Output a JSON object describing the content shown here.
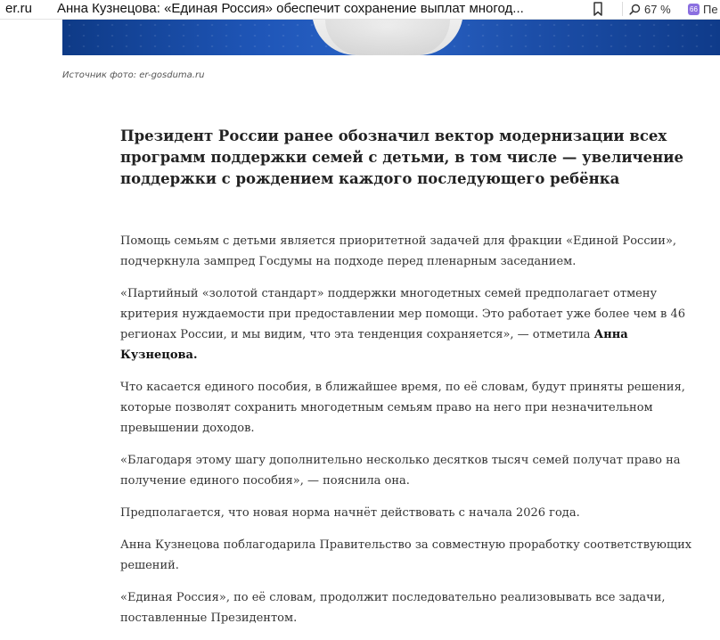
{
  "browser": {
    "site": "er.ru",
    "title": "Анна Кузнецова: «Единая Россия» обеспечит сохранение выплат многод...",
    "zoom": "67 %",
    "extension_label": "Пе",
    "extension_badge": "66"
  },
  "article": {
    "photo_source": "Источник фото: er-gosduma.ru",
    "lead": "Президент России ранее обозначил вектор модернизации всех программ поддержки семей с детьми, в том числе — увеличение поддержки с рождением каждого последующего ребёнка",
    "paragraphs": {
      "p1": "Помощь семьям с детьми является приоритетной задачей для фракции «Единой России», подчеркнула зампред Госдумы на подходе перед пленарным заседанием.",
      "p2_text": "«Партийный «золотой стандарт» поддержки многодетных семей предполагает отмену критерия нуждаемости при предоставлении мер помощи. Это работает уже более чем в 46 регионах России, и мы видим, что эта тенденция сохраняется», — отметила ",
      "p2_bold": "Анна Кузнецова.",
      "p3": "Что касается единого пособия, в ближайшее время, по её словам, будут приняты решения, которые позволят сохранить многодетным семьям право на него при незначительном превышении доходов.",
      "p4": "«Благодаря этому шагу дополнительно несколько десятков тысяч семей получат право на получение единого пособия», — пояснила она.",
      "p5": "Предполагается, что новая норма начнёт действовать с начала 2026 года.",
      "p6": "Анна Кузнецова поблагодарила Правительство за совместную проработку соответствующих решений.",
      "p7": "«Единая Россия», по её словам, продолжит последовательно реализовывать все задачи, поставленные Президентом."
    }
  },
  "icons": {
    "bookmark": "bookmark-icon",
    "zoom": "magnifier-icon"
  }
}
